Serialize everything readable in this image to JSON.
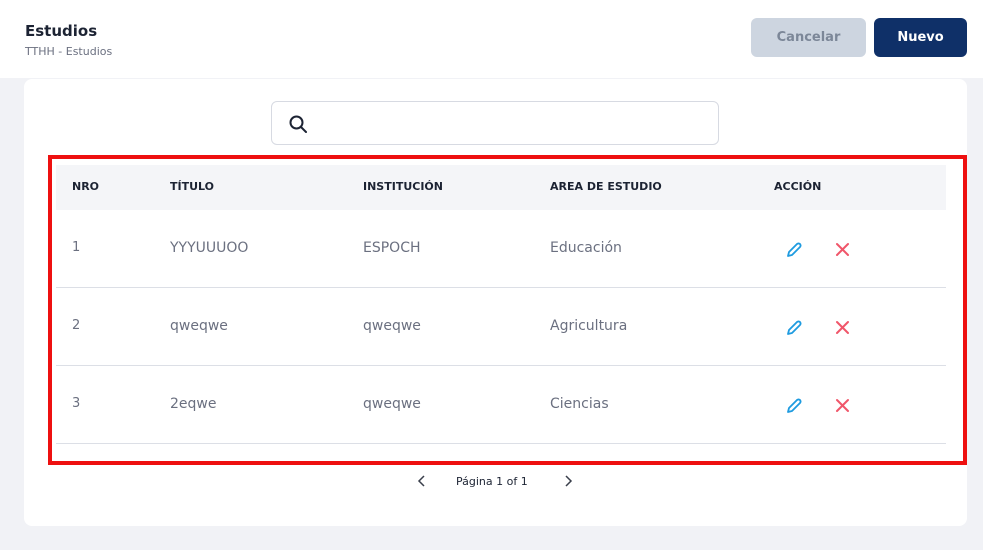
{
  "page": {
    "title": "Estudios",
    "breadcrumb": "TTHH  - Estudios"
  },
  "actions": {
    "cancel_label": "Cancelar",
    "new_label": "Nuevo"
  },
  "search": {
    "value": "",
    "placeholder": ""
  },
  "table": {
    "headers": {
      "nro": "NRO",
      "titulo": "TÍTULO",
      "institucion": "INSTITUCIÓN",
      "area": "AREA DE ESTUDIO",
      "accion": "ACCIÓN"
    },
    "rows": [
      {
        "nro": "1",
        "titulo": "YYYUUUOO",
        "institucion": "ESPOCH",
        "area": "Educación"
      },
      {
        "nro": "2",
        "titulo": "qweqwe",
        "institucion": "qweqwe",
        "area": "Agricultura"
      },
      {
        "nro": "3",
        "titulo": "2eqwe",
        "institucion": "qweqwe",
        "area": "Ciencias"
      }
    ]
  },
  "pagination": {
    "text": "Página 1 of 1"
  },
  "icons": {
    "search": "search-icon",
    "edit": "pencil-icon",
    "delete": "close-icon",
    "prev": "chevron-left-icon",
    "next": "chevron-right-icon"
  },
  "colors": {
    "primary": "#0f3068",
    "cancel_bg": "#cdd5e0",
    "edit": "#1e9be0",
    "delete": "#f0566a",
    "highlight": "#ee1010"
  }
}
